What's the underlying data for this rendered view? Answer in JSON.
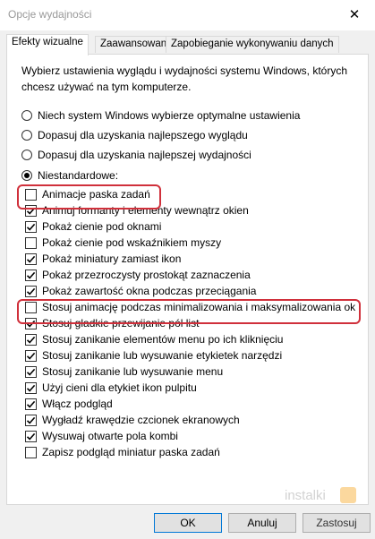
{
  "window": {
    "title": "Opcje wydajności",
    "close_glyph": "✕"
  },
  "tabs": [
    {
      "label": "Efekty wizualne",
      "active": true
    },
    {
      "label": "Zaawansowane",
      "active": false
    },
    {
      "label": "Zapobieganie wykonywaniu danych",
      "active": false
    }
  ],
  "description": "Wybierz ustawienia wyglądu i wydajności systemu Windows, których chcesz używać na tym komputerze.",
  "radio_options": [
    {
      "label": "Niech system Windows wybierze optymalne ustawienia",
      "checked": false
    },
    {
      "label": "Dopasuj dla uzyskania najlepszego wyglądu",
      "checked": false
    },
    {
      "label": "Dopasuj dla uzyskania najlepszej wydajności",
      "checked": false
    },
    {
      "label": "Niestandardowe:",
      "checked": true
    }
  ],
  "effects": [
    {
      "label": "Animacje paska zadań",
      "checked": false
    },
    {
      "label": "Animuj formanty i elementy wewnątrz okien",
      "checked": true
    },
    {
      "label": "Pokaż cienie pod oknami",
      "checked": true
    },
    {
      "label": "Pokaż cienie pod wskaźnikiem myszy",
      "checked": false
    },
    {
      "label": "Pokaż miniatury zamiast ikon",
      "checked": true
    },
    {
      "label": "Pokaż przezroczysty prostokąt zaznaczenia",
      "checked": true
    },
    {
      "label": "Pokaż zawartość okna podczas przeciągania",
      "checked": true
    },
    {
      "label": "Stosuj animację podczas minimalizowania i maksymalizowania ok",
      "checked": false
    },
    {
      "label": "Stosuj gładkie przewijanie pól list",
      "checked": true
    },
    {
      "label": "Stosuj zanikanie elementów menu po ich kliknięciu",
      "checked": true
    },
    {
      "label": "Stosuj zanikanie lub wysuwanie etykietek narzędzi",
      "checked": true
    },
    {
      "label": "Stosuj zanikanie lub wysuwanie menu",
      "checked": true
    },
    {
      "label": "Użyj cieni dla etykiet ikon pulpitu",
      "checked": true
    },
    {
      "label": "Włącz podgląd",
      "checked": true
    },
    {
      "label": "Wygładź krawędzie czcionek ekranowych",
      "checked": true
    },
    {
      "label": "Wysuwaj otwarte pola kombi",
      "checked": true
    },
    {
      "label": "Zapisz podgląd miniatur paska zadań",
      "checked": false
    }
  ],
  "highlighted_items": [
    0,
    7
  ],
  "buttons": {
    "ok": "OK",
    "cancel": "Anuluj",
    "apply": "Zastosuj"
  },
  "watermark": {
    "text": "instalki",
    "accent": "#f5a623"
  },
  "colors": {
    "highlight_border": "#d0303b",
    "default_button_border": "#0078d7"
  }
}
